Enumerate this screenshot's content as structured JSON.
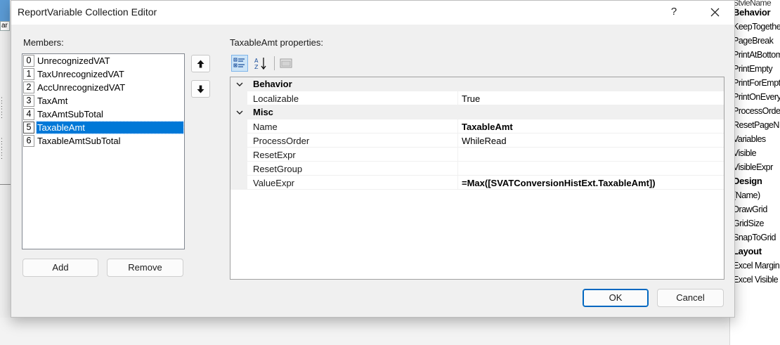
{
  "background": {
    "left_snippet": "ar",
    "right_props": [
      {
        "label": "StyleName",
        "kind": "top"
      },
      {
        "label": "Behavior",
        "kind": "category"
      },
      {
        "label": "KeepTogether",
        "kind": "prop"
      },
      {
        "label": "PageBreak",
        "kind": "prop"
      },
      {
        "label": "PrintAtBottom",
        "kind": "prop"
      },
      {
        "label": "PrintEmpty",
        "kind": "prop"
      },
      {
        "label": "PrintForEmpty",
        "kind": "prop"
      },
      {
        "label": "PrintOnEvery",
        "kind": "prop"
      },
      {
        "label": "ProcessOrder",
        "kind": "prop"
      },
      {
        "label": "ResetPageN",
        "kind": "prop"
      },
      {
        "label": "Variables",
        "kind": "prop"
      },
      {
        "label": "Visible",
        "kind": "prop"
      },
      {
        "label": "VisibleExpr",
        "kind": "prop"
      },
      {
        "label": "Design",
        "kind": "category"
      },
      {
        "label": "(Name)",
        "kind": "prop"
      },
      {
        "label": "DrawGrid",
        "kind": "prop"
      },
      {
        "label": "GridSize",
        "kind": "prop"
      },
      {
        "label": "SnapToGrid",
        "kind": "prop"
      },
      {
        "label": "Layout",
        "kind": "category"
      },
      {
        "label": "Excel Margin",
        "kind": "prop"
      },
      {
        "label": "Excel Visible",
        "kind": "prop"
      }
    ]
  },
  "dialog": {
    "title": "ReportVariable Collection Editor",
    "help_label": "?",
    "members_label": "Members:",
    "properties_label": "TaxableAmt properties:",
    "members": [
      {
        "index": "0",
        "name": "UnrecognizedVAT"
      },
      {
        "index": "1",
        "name": "TaxUnrecognizedVAT"
      },
      {
        "index": "2",
        "name": "AccUnrecognizedVAT"
      },
      {
        "index": "3",
        "name": "TaxAmt"
      },
      {
        "index": "4",
        "name": "TaxAmtSubTotal"
      },
      {
        "index": "5",
        "name": "TaxableAmt",
        "selected": true
      },
      {
        "index": "6",
        "name": "TaxableAmtSubTotal"
      }
    ],
    "add_label": "Add",
    "remove_label": "Remove",
    "ok_label": "OK",
    "cancel_label": "Cancel",
    "property_grid": [
      {
        "type": "category",
        "label": "Behavior"
      },
      {
        "type": "prop",
        "name": "Localizable",
        "value": "True",
        "bold": false
      },
      {
        "type": "category",
        "label": "Misc"
      },
      {
        "type": "prop",
        "name": "Name",
        "value": "TaxableAmt",
        "bold": true
      },
      {
        "type": "prop",
        "name": "ProcessOrder",
        "value": "WhileRead",
        "bold": false
      },
      {
        "type": "prop",
        "name": "ResetExpr",
        "value": "",
        "bold": false
      },
      {
        "type": "prop",
        "name": "ResetGroup",
        "value": "",
        "bold": false
      },
      {
        "type": "prop",
        "name": "ValueExpr",
        "value": "=Max([SVATConversionHistExt.TaxableAmt])",
        "bold": true
      }
    ]
  },
  "colors": {
    "selection": "#0078d7",
    "dialog_bg": "#f0f0f0",
    "primary_border": "#0067c0"
  }
}
